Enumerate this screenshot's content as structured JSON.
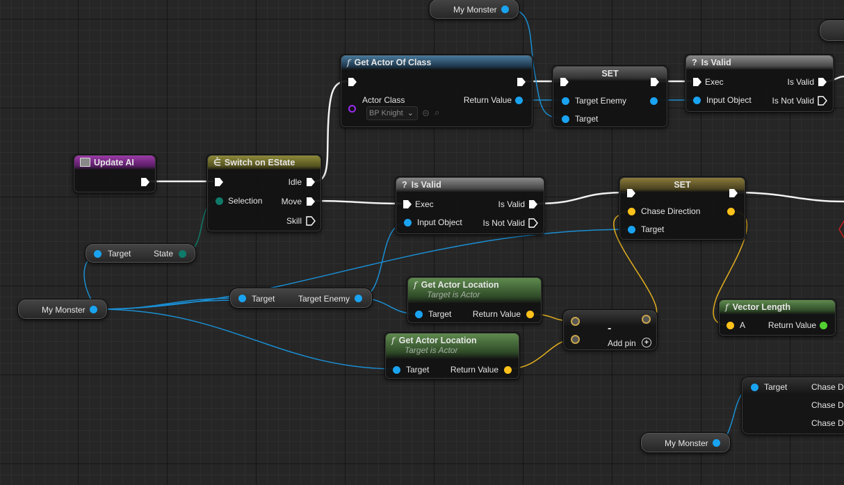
{
  "graph": {
    "update_ai": {
      "title": "Update AI"
    },
    "switch": {
      "title": "Switch on EState",
      "selection": "Selection",
      "idle": "Idle",
      "move": "Move",
      "skill": "Skill"
    },
    "state_node": {
      "target": "Target",
      "state": "State"
    },
    "my_monster_vars": [
      "My Monster",
      "My Monster",
      "My Monster"
    ],
    "get_actor_of_class": {
      "title": "Get Actor Of Class",
      "actor_class": "Actor Class",
      "return_value": "Return Value",
      "class_value": "BP Knight"
    },
    "set_target_enemy": {
      "title": "SET",
      "target_enemy": "Target Enemy",
      "target": "Target"
    },
    "is_valid_top": {
      "title": "Is Valid",
      "exec": "Exec",
      "input_object": "Input Object",
      "is_valid": "Is Valid",
      "is_not_valid": "Is Not Valid"
    },
    "is_valid_mid": {
      "title": "Is Valid",
      "exec": "Exec",
      "input_object": "Input Object",
      "is_valid": "Is Valid",
      "is_not_valid": "Is Not Valid"
    },
    "set_chase": {
      "title": "SET",
      "chase_direction": "Chase Direction",
      "target": "Target"
    },
    "target_enemy_node": {
      "target": "Target",
      "target_enemy": "Target Enemy"
    },
    "get_loc_1": {
      "title": "Get Actor Location",
      "subtitle": "Target is Actor",
      "target": "Target",
      "return_value": "Return Value"
    },
    "get_loc_2": {
      "title": "Get Actor Location",
      "subtitle": "Target is Actor",
      "target": "Target",
      "return_value": "Return Value"
    },
    "subtract": {
      "symbol": "-",
      "add_pin": "Add pin"
    },
    "vector_length": {
      "title": "Vector Length",
      "a": "A",
      "return_value": "Return Value"
    },
    "chase_node": {
      "target": "Target",
      "rows": [
        "Chase Di",
        "Chase Di",
        "Chase Di"
      ]
    }
  },
  "colors": {
    "object_pin": "#1aa3f0",
    "vector_pin": "#ffc21a",
    "float_pin": "#52d130",
    "enum_pin": "#0e7a6a",
    "exec_wire": "#ffffff"
  }
}
